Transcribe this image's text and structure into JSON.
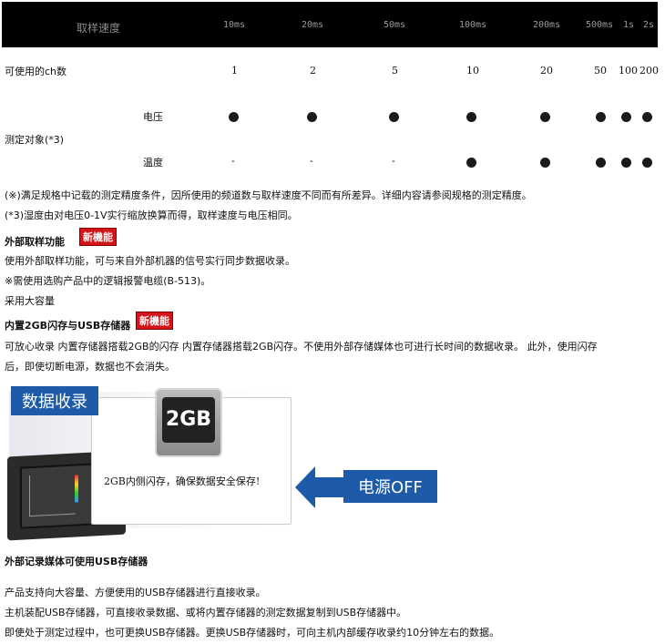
{
  "table": {
    "header_label": "取样速度",
    "speeds": [
      "10ms",
      "20ms",
      "50ms",
      "100ms",
      "200ms",
      "500ms",
      "1s",
      "2s"
    ],
    "ch_label": "可使用的ch数",
    "ch_values": [
      "1",
      "2",
      "5",
      "10",
      "20",
      "50",
      "100",
      "200"
    ],
    "measure_label": "测定对象(*3)",
    "voltage_label": "电压",
    "voltage": [
      "●",
      "●",
      "●",
      "●",
      "●",
      "●",
      "●",
      "●"
    ],
    "temp_label": "温度",
    "temp": [
      "-",
      "-",
      "-",
      "●",
      "●",
      "●",
      "●",
      "●"
    ]
  },
  "notes": {
    "note1": "(※)满足规格中记载的测定精度条件，因所使用的频道数与取样速度不同而有所差异。详细内容请参阅规格的测定精度。",
    "note2": "(*3)湿度由对电压0-1V实行缩放换算而得，取样速度与电压相同。"
  },
  "section1": {
    "title": "外部取样功能",
    "badge": "新機能",
    "line1": "使用外部取样功能，可与来自外部机器的信号实行同步数据收录。",
    "line2": "※需使用选购产品中的逻辑报警电缆(B-513)。",
    "line3": "采用大容量"
  },
  "section2": {
    "title": "内置2GB闪存与USB存储器",
    "badge": "新機能",
    "line1": "可放心收录 内置存储器搭载2GB的闪存 内置存储器搭载2GB闪存。不使用外部存储媒体也可进行长时间的数据收录。 此外，使用闪存",
    "line2": "后，即使切断电源，数据也不会消失。"
  },
  "illustration": {
    "label_record": "数据收录",
    "chip_text": "2GB",
    "caption": "2GB内侧闪存，确保数据安全保存!",
    "label_power": "电源OFF"
  },
  "section3": {
    "title": "外部记录媒体可使用USB存储器",
    "line1": "产品支持向大容量、方便使用的USB存储器进行直接收录。",
    "line2": "主机装配USB存储器，可直接收录数据、或将内置存储器的测定数据复制到USB存储器中。",
    "line3": "即使处于测定过程中，也可更换USB存储器。更换USB存储器时，可向主机内部缓存收录约10分钟左右的数据。"
  },
  "colors": {
    "header_bg": "#000000",
    "badge_red": "#d4141b",
    "label_blue": "#1d5aa8"
  }
}
